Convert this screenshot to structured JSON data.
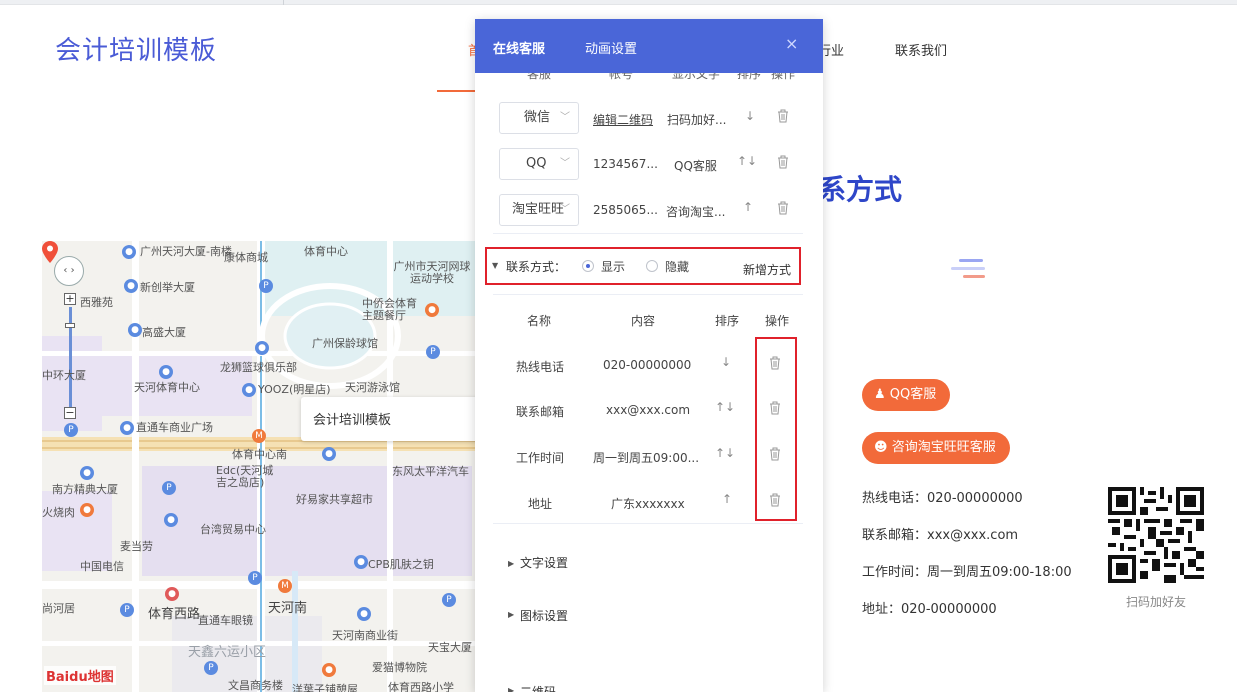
{
  "site": {
    "title": "会计培训模板",
    "nav": [
      {
        "label": "首页"
      },
      {
        "label": "行业"
      },
      {
        "label": "联系我们"
      }
    ],
    "section_title": "系方式"
  },
  "panel": {
    "tabs": [
      {
        "label": "在线客服"
      },
      {
        "label": "动画设置"
      }
    ],
    "close_label": "×",
    "service_headers": [
      "客服",
      "帐号",
      "显示文字",
      "排序",
      "操作"
    ],
    "services": [
      {
        "type": "微信",
        "account": "编辑二维码",
        "display": "扫码加好...",
        "sort": "↓"
      },
      {
        "type": "QQ",
        "account": "1234567...",
        "display": "QQ客服",
        "sort": "↑↓"
      },
      {
        "type": "淘宝旺旺",
        "account": "2585065...",
        "display": "咨询淘宝...",
        "sort": "↑"
      }
    ],
    "contact_mode": {
      "label": "联系方式：",
      "show_label": "显示",
      "hide_label": "隐藏",
      "selected": "显示",
      "add_label": "新增方式"
    },
    "contact_headers": {
      "name": "名称",
      "content": "内容",
      "sort": "排序",
      "action": "操作"
    },
    "contacts": [
      {
        "name": "热线电话",
        "content": "020-00000000",
        "sort": "↓"
      },
      {
        "name": "联系邮箱",
        "content": "xxx@xxx.com",
        "sort": "↑↓"
      },
      {
        "name": "工作时间",
        "content": "周一到周五09:00...",
        "sort": "↑↓"
      },
      {
        "name": "地址",
        "content": "广东xxxxxxx",
        "sort": "↑"
      }
    ],
    "sections": [
      {
        "label": "文字设置"
      },
      {
        "label": "图标设置"
      },
      {
        "label": "二维码"
      }
    ]
  },
  "map": {
    "popup_title": "会计培训模板",
    "logo": "Baidu地图",
    "labels": [
      "广州天河大厦-南楼",
      "康体商城",
      "体育中心",
      "广州市天河网球运动学校",
      "新创举大厦",
      "西雅苑",
      "中侨会体育主题餐厅",
      "高盛大厦",
      "广州保龄球馆",
      "龙狮篮球俱乐部",
      "中环大厦",
      "天河体育中心",
      "YOOZ(明星店)",
      "天河游泳馆",
      "直通车商业广场",
      "体育中心南",
      "东风太平洋汽车",
      "南方精典大厦",
      "Edc(天河城吉之岛店)",
      "好易家共享超市",
      "火烧肉",
      "台湾贸易中心",
      "麦当劳",
      "中国电信",
      "CPB肌肤之钥",
      "尚河居",
      "体育西路",
      "天河南",
      "直通车眼镜",
      "天河南商业街",
      "天宝大厦",
      "天鑫六运小区",
      "爱猫博物院",
      "文昌商务楼",
      "洋葉子铺憩屋",
      "体育西路小学"
    ]
  },
  "widget": {
    "buttons": [
      {
        "label": "QQ客服"
      },
      {
        "label": "咨询淘宝旺旺客服"
      }
    ],
    "contact_lines": [
      "热线电话：020-00000000",
      "联系邮箱：xxx@xxx.com",
      "工作时间：周一到周五09:00-18:00",
      "地址：020-00000000"
    ],
    "qr_caption": "扫码加好友"
  },
  "colors": {
    "brand_blue": "#4a66d8",
    "accent_orange": "#f26a3a",
    "highlight_red": "#e0212b"
  }
}
